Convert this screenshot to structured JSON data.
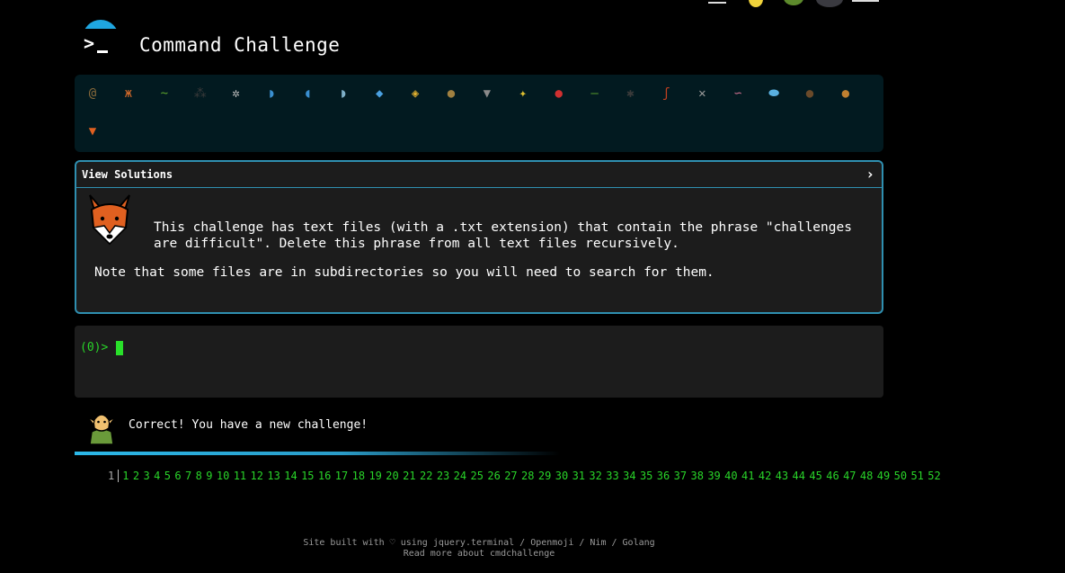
{
  "header": {
    "title": "Command Challenge",
    "logo_icon": "terminal-prompt-icon"
  },
  "top_icons": [
    "menu-icon",
    "lightbulb-icon",
    "turtle-icon",
    "avatar-icon",
    "hamburger-icon"
  ],
  "challenge_icons": [
    {
      "name": "snail",
      "color": "#8a6a3a",
      "glyph": "@"
    },
    {
      "name": "butterfly",
      "color": "#d46a2a",
      "glyph": "ж"
    },
    {
      "name": "caterpillar",
      "color": "#5aa02c",
      "glyph": "~"
    },
    {
      "name": "ant",
      "color": "#3a3a3a",
      "glyph": "⁂"
    },
    {
      "name": "spider-web",
      "color": "#bbbbbb",
      "glyph": "✲"
    },
    {
      "name": "whale",
      "color": "#3a8fd0",
      "glyph": "◗"
    },
    {
      "name": "dolphin",
      "color": "#3a8fd0",
      "glyph": "◖"
    },
    {
      "name": "dolphin-2",
      "color": "#7fb0c8",
      "glyph": "◗"
    },
    {
      "name": "fish",
      "color": "#4aa0e0",
      "glyph": "◆"
    },
    {
      "name": "tropical-fish",
      "color": "#e0b030",
      "glyph": "◈"
    },
    {
      "name": "pufferfish",
      "color": "#a08040",
      "glyph": "●"
    },
    {
      "name": "wolf",
      "color": "#8a8a8a",
      "glyph": "▼"
    },
    {
      "name": "bee",
      "color": "#e0c030",
      "glyph": "✦"
    },
    {
      "name": "ladybug",
      "color": "#d03030",
      "glyph": "●"
    },
    {
      "name": "cricket",
      "color": "#5aa02c",
      "glyph": "—"
    },
    {
      "name": "spider",
      "color": "#3a3a3a",
      "glyph": "✱"
    },
    {
      "name": "scorpion",
      "color": "#c04020",
      "glyph": "ʃ"
    },
    {
      "name": "fly",
      "color": "#9a9a9a",
      "glyph": "✕"
    },
    {
      "name": "worm",
      "color": "#d07090",
      "glyph": "∽"
    },
    {
      "name": "microbe",
      "color": "#5ab0e0",
      "glyph": "⬬"
    },
    {
      "name": "gorilla",
      "color": "#6a4a2a",
      "glyph": "●"
    },
    {
      "name": "dog",
      "color": "#c08030",
      "glyph": "●"
    },
    {
      "name": "fox",
      "color": "#e06020",
      "glyph": "▼"
    }
  ],
  "panel": {
    "toggle_label": "View Solutions",
    "chevron": "›",
    "description": "This challenge has text files (with a .txt extension) that contain the phrase \"challenges\nare difficult\". Delete this phrase from all text files recursively.",
    "note": "Note that some files are in subdirectories so you will need to search for them."
  },
  "terminal": {
    "prompt": "(0)>"
  },
  "status": {
    "message": "Correct! You have a new challenge!"
  },
  "pagination": {
    "current": "1",
    "pages": [
      "1",
      "2",
      "3",
      "4",
      "5",
      "6",
      "7",
      "8",
      "9",
      "10",
      "11",
      "12",
      "13",
      "14",
      "15",
      "16",
      "17",
      "18",
      "19",
      "20",
      "21",
      "22",
      "23",
      "24",
      "25",
      "26",
      "27",
      "28",
      "29",
      "30",
      "31",
      "32",
      "33",
      "34",
      "35",
      "36",
      "37",
      "38",
      "39",
      "40",
      "41",
      "42",
      "43",
      "44",
      "45",
      "46",
      "47",
      "48",
      "49",
      "50",
      "51",
      "52"
    ]
  },
  "footer": {
    "line1": "Site built with ♡ using jquery.terminal / Openmoji / Nim / Golang",
    "line2": "Read more about cmdchallenge"
  }
}
